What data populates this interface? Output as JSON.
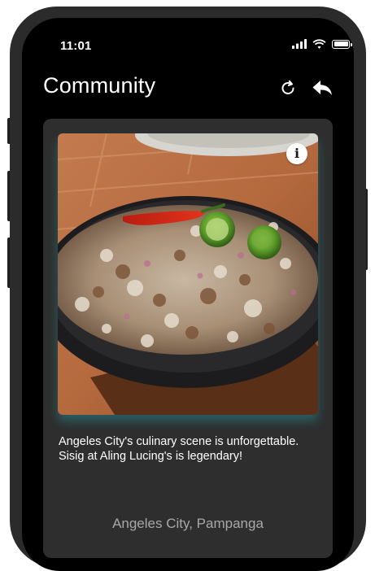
{
  "status_bar": {
    "time": "11:01",
    "icons": [
      "cellular-signal-icon",
      "wifi-icon",
      "battery-icon"
    ]
  },
  "header": {
    "title": "Community",
    "actions": [
      "refresh-icon",
      "reply-arrow-icon"
    ]
  },
  "post": {
    "photo_subject": "sizzling sisig on a cast iron plate with chili and calamansi",
    "info_button": "i",
    "caption": "Angeles City's culinary scene is unforgettable. Sisig at Aling Lucing's is legendary!",
    "location": "Angeles City, Pampanga"
  },
  "colors": {
    "background": "#000000",
    "card": "#2e2e2e",
    "photo_glow": "#2896a0",
    "text": "#ffffff",
    "location_text": "#a8a8a8"
  }
}
